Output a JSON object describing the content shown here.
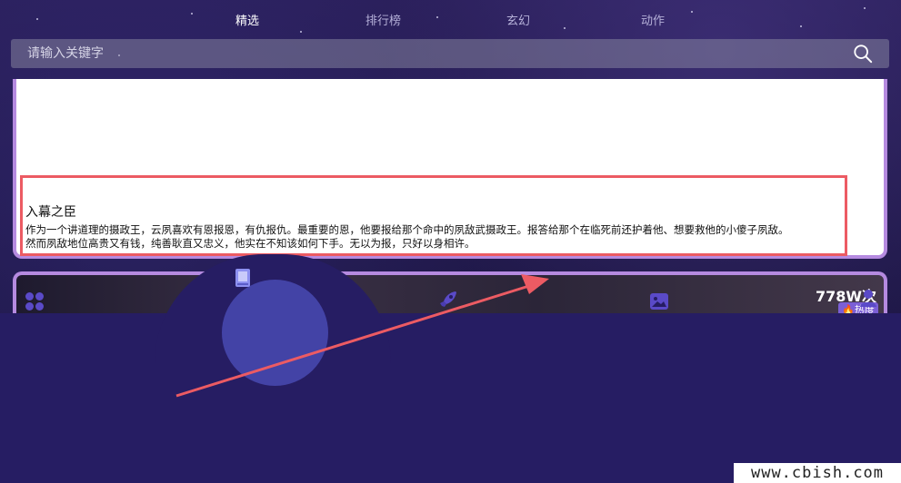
{
  "tabs": [
    {
      "label": "精选",
      "active": true
    },
    {
      "label": "排行榜",
      "active": false
    },
    {
      "label": "玄幻",
      "active": false
    },
    {
      "label": "动作",
      "active": false
    }
  ],
  "search": {
    "placeholder": "请输入关键字",
    "value": "",
    "icon": "search-icon"
  },
  "book": {
    "title": "入幕之臣",
    "description_line1": "作为一个讲道理的摄政王，云夙喜欢有恩报恩，有仇报仇。最重要的恩，他要报给那个命中的夙敌武摄政王。报答给那个在临死前还护着他、想要救他的小傻子夙敌。",
    "description_line2": "然而夙敌地位高贵又有钱，纯善耿直又忠义，他实在不知该如何下手。无以为报，只好以身相许。"
  },
  "card2": {
    "views": "778W次",
    "hot_label": "热度"
  },
  "bottom_nav": [
    {
      "icon": "grid-icon"
    },
    {
      "icon": "book-icon"
    },
    {
      "icon": "rocket-icon"
    },
    {
      "icon": "image-icon"
    },
    {
      "icon": "user-icon"
    }
  ],
  "colors": {
    "accent": "#b58ae0",
    "highlight": "#ec5b63",
    "nav_bg": "#261d63"
  },
  "watermark": "www.cbish.com"
}
